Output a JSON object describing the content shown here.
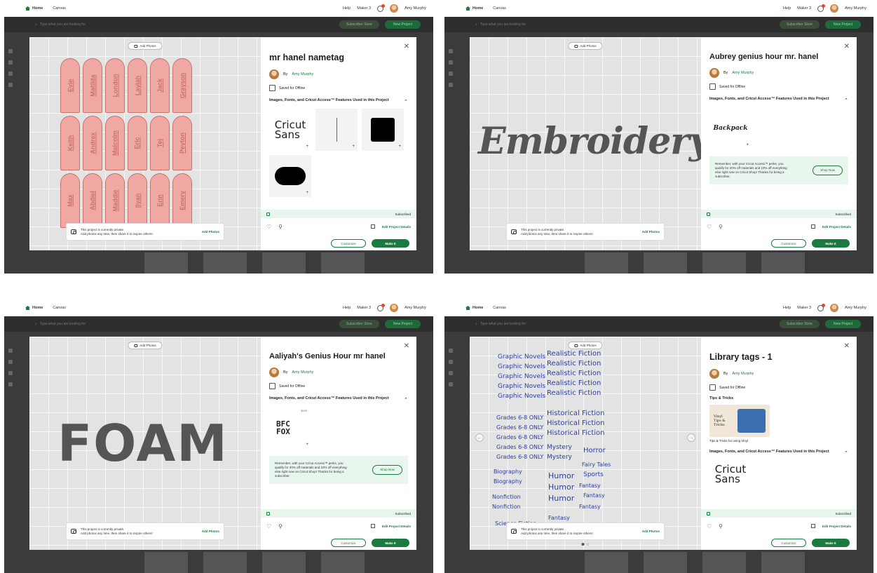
{
  "app": {
    "nav": {
      "home": "Home",
      "canvas": "Canvas",
      "help": "Help",
      "machine": "Maker 3",
      "user": "Amy Murphy"
    },
    "search_placeholder": "Type what you are looking for",
    "subscriber_store": "Subscriber Store",
    "new_project": "New Project"
  },
  "common": {
    "add_photos": "Add Photos",
    "by": "By",
    "saved_offline": "Saved for Offline",
    "features_heading": "Images, Fonts, and Cricut Access™ Features Used in this Project",
    "privacy_line1": "This project is currently private.",
    "privacy_line2": "Add photos any time, then share it to inspire others!",
    "subscribed": "Subscribed",
    "edit_details": "Edit Project Details",
    "customize": "Customize",
    "make_it": "Make It",
    "perks_text": "Remember, with your Cricut Access™ perks, you qualify for 20% off materials and 10% off everything else right now on Cricut Shop! Thanks for being a subscriber.",
    "shop_now": "Shop Now"
  },
  "panels": [
    {
      "title": "mr hanel nametag",
      "author": "Amy Murphy"
    },
    {
      "title": "Aubrey genius hour mr. hanel",
      "author": "Amy Murphy",
      "canvas_text": "Embroidery",
      "asset_label": "Backpack"
    },
    {
      "title": "Aaliyah's Genius Hour mr hanel",
      "author": "Amy Murphy",
      "canvas_text": "FOAM",
      "asset_label": "BFC FOX",
      "asset_price": "$3.99"
    },
    {
      "title": "Library tags - 1",
      "author": "Amy Murphy",
      "tips_heading": "Tips & Tricks",
      "tips_caption": "Tips & Tricks for using Vinyl",
      "tips_thumb_text": "Vinyl Tips & Tricks"
    }
  ],
  "nametags": [
    "Evie",
    "Matilda",
    "London",
    "Laylah",
    "Jack",
    "Grayson",
    "Keith",
    "Andrex",
    "Malcolm",
    "Eric",
    "Tej",
    "Peyton",
    "Max",
    "Abdiel",
    "Maddie",
    "Ilyan",
    "Erin",
    "Emery"
  ],
  "cricut_sans": {
    "line1": "Cricut",
    "line2": "Sans"
  },
  "library_tags": [
    "Graphic Novels",
    "Graphic Novels",
    "Graphic Novels",
    "Graphic Novels",
    "Graphic Novels",
    "Realistic Fiction",
    "Realistic Fiction",
    "Realistic Fiction",
    "Realistic Fiction",
    "Realistic Fiction",
    "Historical Fiction",
    "Historical Fiction",
    "Historical Fiction",
    "Grades 6-8 ONLY",
    "Grades 6-8 ONLY",
    "Grades 6-8 ONLY",
    "Grades 6-8 ONLY",
    "Grades 6-8 ONLY",
    "Mystery",
    "Mystery",
    "Horror",
    "Fairy Tales",
    "Sports",
    "Biography",
    "Biography",
    "Humor",
    "Humor",
    "Humor",
    "Fantasy",
    "Fantasy",
    "Fantasy",
    "Fantasy",
    "Nonfiction",
    "Nonfiction",
    "Science Fiction"
  ],
  "colors": {
    "accent": "#1a7a3f",
    "tag_fill": "#f0a8a3",
    "tag_stroke": "#c9726d",
    "library_text": "#2e3d9c",
    "perks_bg": "#e9f6ee"
  }
}
